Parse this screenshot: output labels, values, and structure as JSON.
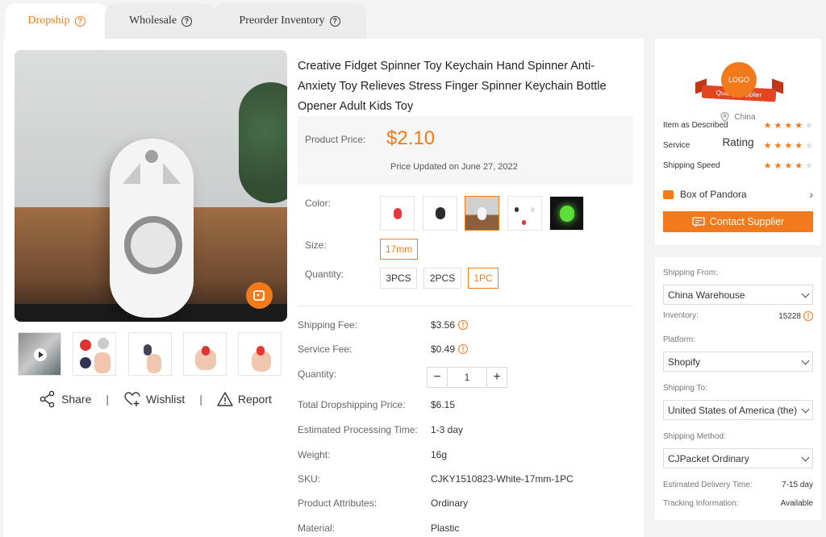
{
  "tabs": [
    {
      "label": "Dropship",
      "active": true
    },
    {
      "label": "Wholesale",
      "active": false
    },
    {
      "label": "Preorder Inventory",
      "active": false
    }
  ],
  "product": {
    "title": "Creative Fidget Spinner Toy Keychain Hand Spinner Anti-Anxiety Toy Relieves Stress Finger Spinner Keychain Bottle Opener Adult Kids Toy",
    "price_label": "Product Price:",
    "price": "$2.10",
    "price_updated": "Price Updated on June 27, 2022",
    "color_label": "Color:",
    "size_label": "Size:",
    "size_options": [
      "17mm"
    ],
    "quantity_label": "Quantity:",
    "quantity_options": [
      "3PCS",
      "2PCS",
      "1PC"
    ],
    "selected_quantity": "1PC"
  },
  "actions": {
    "share": "Share",
    "wishlist": "Wishlist",
    "report": "Report",
    "separator": "|"
  },
  "details": {
    "shipping_fee": {
      "label": "Shipping Fee:",
      "value": "$3.56"
    },
    "service_fee": {
      "label": "Service Fee:",
      "value": "$0.49"
    },
    "quantity": {
      "label": "Quantity:",
      "value": "1"
    },
    "total": {
      "label": "Total Dropshipping Price:",
      "value": "$6.15"
    },
    "processing": {
      "label": "Estimated Processing Time:",
      "value": "1-3 day"
    },
    "weight": {
      "label": "Weight:",
      "value": "16g"
    },
    "sku": {
      "label": "SKU:",
      "value": "CJKY1510823-White-17mm-1PC"
    },
    "attributes": {
      "label": "Product Attributes:",
      "value": "Ordinary"
    },
    "material": {
      "label": "Material:",
      "value": "Plastic"
    }
  },
  "supplier": {
    "logo_text": "LOGO",
    "badge": "Quality Supplier",
    "location": "China",
    "rating_title": "Rating",
    "ratings": [
      {
        "label": "Item as Described",
        "stars": 4
      },
      {
        "label": "Service",
        "stars": 4
      },
      {
        "label": "Shipping Speed",
        "stars": 4
      }
    ],
    "store_name": "Box of Pandora",
    "contact_label": "Contact Supplier"
  },
  "shipping": {
    "from_label": "Shipping From:",
    "from_value": "China Warehouse",
    "inventory_label": "Inventory:",
    "inventory_value": "15228",
    "platform_label": "Platform:",
    "platform_value": "Shopify",
    "to_label": "Shipping To:",
    "to_value": "United States of America (the)",
    "method_label": "Shipping Method:",
    "method_value": "CJPacket Ordinary",
    "delivery_label": "Estimated Delivery Time:",
    "delivery_value": "7-15 day",
    "tracking_label": "Tracking Information:",
    "tracking_value": "Available"
  },
  "colors": {
    "accent": "#f27a1a",
    "ribbon": "#e2451f"
  }
}
